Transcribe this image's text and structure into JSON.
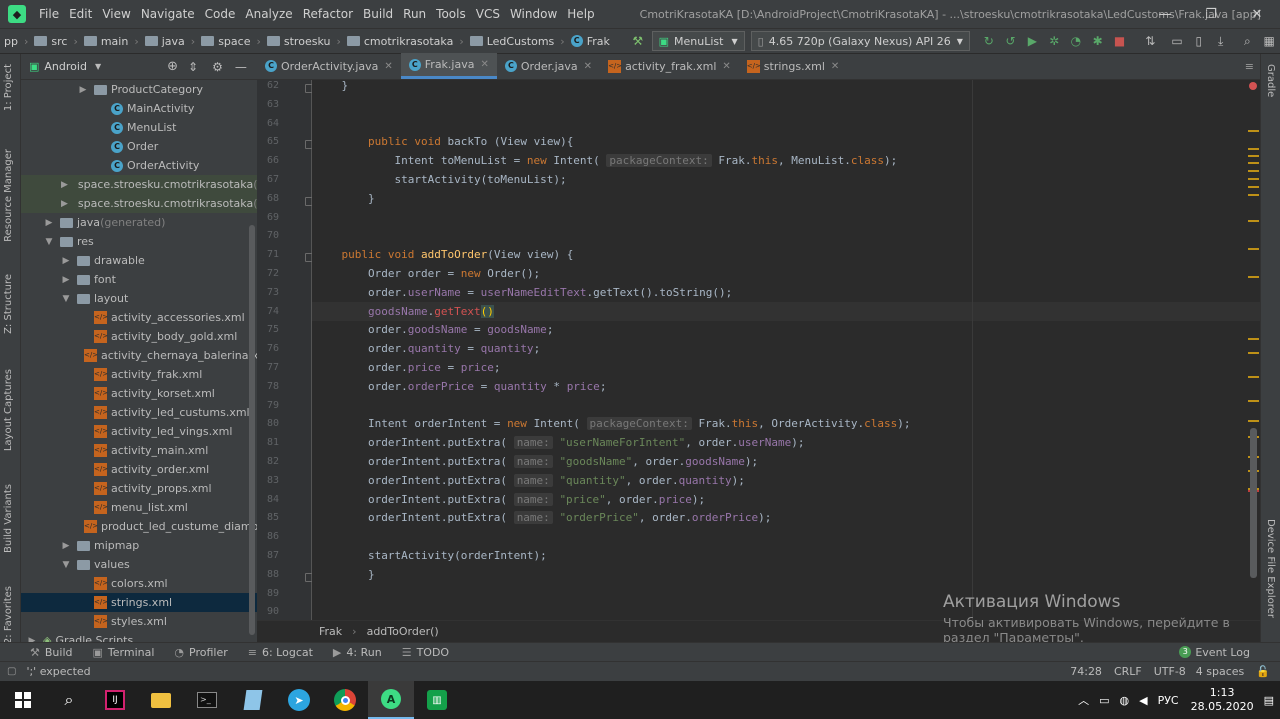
{
  "menubar": {
    "items": [
      "File",
      "Edit",
      "View",
      "Navigate",
      "Code",
      "Analyze",
      "Refactor",
      "Build",
      "Run",
      "Tools",
      "VCS",
      "Window",
      "Help"
    ],
    "title": "CmotriKrasotaKA [D:\\AndroidProject\\CmotriKrasotaKA] - ...\\stroesku\\cmotrikrasotaka\\LedCustoms\\Frak.java [app]"
  },
  "navbar": {
    "crumbs": [
      "pp",
      "src",
      "main",
      "java",
      "space",
      "stroesku",
      "cmotrikrasotaka",
      "LedCustoms",
      "Frak"
    ],
    "config": "MenuList",
    "device": "4.65  720p (Galaxy Nexus) API 26"
  },
  "project": {
    "view": "Android",
    "tree": [
      {
        "label": "ProductCategory",
        "type": "folder",
        "indent": 3,
        "arrow": "▶"
      },
      {
        "label": "MainActivity",
        "type": "class",
        "indent": 4
      },
      {
        "label": "MenuList",
        "type": "class",
        "indent": 4
      },
      {
        "label": "Order",
        "type": "class",
        "indent": 4
      },
      {
        "label": "OrderActivity",
        "type": "class",
        "indent": 4
      },
      {
        "label": "space.stroesku.cmotrikrasotaka",
        "suffix": " (a",
        "type": "pkg",
        "indent": 2,
        "arrow": "▶",
        "hl": "green"
      },
      {
        "label": "space.stroesku.cmotrikrasotaka",
        "suffix": " (t",
        "type": "pkg",
        "indent": 2,
        "arrow": "▶",
        "hl": "green"
      },
      {
        "label": "java",
        "suffix": " (generated)",
        "type": "folder",
        "indent": 1,
        "arrow": "▶"
      },
      {
        "label": "res",
        "type": "folder",
        "indent": 1,
        "arrow": "▼"
      },
      {
        "label": "drawable",
        "type": "folder",
        "indent": 2,
        "arrow": "▶"
      },
      {
        "label": "font",
        "type": "folder",
        "indent": 2,
        "arrow": "▶"
      },
      {
        "label": "layout",
        "type": "folder",
        "indent": 2,
        "arrow": "▼"
      },
      {
        "label": "activity_accessories.xml",
        "type": "xml",
        "indent": 3
      },
      {
        "label": "activity_body_gold.xml",
        "type": "xml",
        "indent": 3
      },
      {
        "label": "activity_chernaya_balerina.xml",
        "type": "xml",
        "indent": 3
      },
      {
        "label": "activity_frak.xml",
        "type": "xml",
        "indent": 3
      },
      {
        "label": "activity_korset.xml",
        "type": "xml",
        "indent": 3
      },
      {
        "label": "activity_led_custums.xml",
        "type": "xml",
        "indent": 3
      },
      {
        "label": "activity_led_vings.xml",
        "type": "xml",
        "indent": 3
      },
      {
        "label": "activity_main.xml",
        "type": "xml",
        "indent": 3
      },
      {
        "label": "activity_order.xml",
        "type": "xml",
        "indent": 3
      },
      {
        "label": "activity_props.xml",
        "type": "xml",
        "indent": 3
      },
      {
        "label": "menu_list.xml",
        "type": "xml",
        "indent": 3
      },
      {
        "label": "product_led_custume_diamond",
        "type": "xml",
        "indent": 3
      },
      {
        "label": "mipmap",
        "type": "folder",
        "indent": 2,
        "arrow": "▶"
      },
      {
        "label": "values",
        "type": "folder",
        "indent": 2,
        "arrow": "▼"
      },
      {
        "label": "colors.xml",
        "type": "xml",
        "indent": 3
      },
      {
        "label": "strings.xml",
        "type": "xml",
        "indent": 3,
        "hl": "sel"
      },
      {
        "label": "styles.xml",
        "type": "xml",
        "indent": 3
      },
      {
        "label": "Gradle Scripts",
        "type": "gradle",
        "indent": 0,
        "arrow": "▶"
      }
    ]
  },
  "left_tabs": [
    "1: Project",
    "Resource Manager",
    "Z: Structure",
    "Layout Captures",
    "Build Variants",
    "2: Favorites"
  ],
  "right_tabs": [
    "Gradle",
    "Device File Explorer"
  ],
  "tabs": [
    {
      "label": "OrderActivity.java",
      "active": false
    },
    {
      "label": "Frak.java",
      "active": true
    },
    {
      "label": "Order.java",
      "active": false
    },
    {
      "label": "activity_frak.xml",
      "active": false,
      "xml": true
    },
    {
      "label": "strings.xml",
      "active": false,
      "xml": true
    }
  ],
  "code": [
    {
      "n": 62,
      "s": [
        [
          "    }",
          ""
        ]
      ]
    },
    {
      "n": 63,
      "s": []
    },
    {
      "n": 64,
      "s": []
    },
    {
      "n": 65,
      "s": [
        [
          "        ",
          ""
        ],
        [
          "public void ",
          "kw"
        ],
        [
          "backTo",
          ""
        ],
        [
          " (View view){",
          ""
        ]
      ]
    },
    {
      "n": 66,
      "s": [
        [
          "            Intent toMenuList = ",
          ""
        ],
        [
          "new ",
          "kw"
        ],
        [
          "Intent( ",
          ""
        ],
        [
          "packageContext:",
          "hint"
        ],
        [
          " Frak.",
          ""
        ],
        [
          "this",
          "kw"
        ],
        [
          ", MenuList.",
          ""
        ],
        [
          "class",
          "kw"
        ],
        [
          ");",
          ""
        ]
      ]
    },
    {
      "n": 67,
      "s": [
        [
          "            startActivity(toMenuList);",
          ""
        ]
      ]
    },
    {
      "n": 68,
      "s": [
        [
          "        }",
          ""
        ]
      ]
    },
    {
      "n": 69,
      "s": []
    },
    {
      "n": 70,
      "s": []
    },
    {
      "n": 71,
      "s": [
        [
          "    ",
          ""
        ],
        [
          "public void ",
          "kw"
        ],
        [
          "addToOrder",
          "fn"
        ],
        [
          "(View view) {",
          ""
        ]
      ]
    },
    {
      "n": 72,
      "s": [
        [
          "        Order order = ",
          ""
        ],
        [
          "new ",
          "kw"
        ],
        [
          "Order();",
          ""
        ]
      ]
    },
    {
      "n": 73,
      "s": [
        [
          "        order.",
          ""
        ],
        [
          "userName",
          "fld"
        ],
        [
          " = ",
          ""
        ],
        [
          "userNameEditText",
          "fld"
        ],
        [
          ".getText().toString();",
          ""
        ]
      ]
    },
    {
      "n": 74,
      "s": [
        [
          "        ",
          ""
        ],
        [
          "goodsName",
          "fld"
        ],
        [
          ".",
          ""
        ],
        [
          "getText",
          "err"
        ],
        [
          "()",
          "tcur"
        ]
      ],
      "cur": true
    },
    {
      "n": 75,
      "s": [
        [
          "        order.",
          ""
        ],
        [
          "goodsName",
          "fld"
        ],
        [
          " = ",
          ""
        ],
        [
          "goodsName",
          "fld"
        ],
        [
          ";",
          ""
        ]
      ]
    },
    {
      "n": 76,
      "s": [
        [
          "        order.",
          ""
        ],
        [
          "quantity",
          "fld"
        ],
        [
          " = ",
          ""
        ],
        [
          "quantity",
          "fld"
        ],
        [
          ";",
          ""
        ]
      ]
    },
    {
      "n": 77,
      "s": [
        [
          "        order.",
          ""
        ],
        [
          "price",
          "fld"
        ],
        [
          " = ",
          ""
        ],
        [
          "price",
          "fld"
        ],
        [
          ";",
          ""
        ]
      ]
    },
    {
      "n": 78,
      "s": [
        [
          "        order.",
          ""
        ],
        [
          "orderPrice",
          "fld"
        ],
        [
          " = ",
          ""
        ],
        [
          "quantity",
          "fld"
        ],
        [
          " * ",
          ""
        ],
        [
          "price",
          "fld"
        ],
        [
          ";",
          ""
        ]
      ]
    },
    {
      "n": 79,
      "s": []
    },
    {
      "n": 80,
      "s": [
        [
          "        Intent orderIntent = ",
          ""
        ],
        [
          "new ",
          "kw"
        ],
        [
          "Intent( ",
          ""
        ],
        [
          "packageContext:",
          "hint"
        ],
        [
          " Frak.",
          ""
        ],
        [
          "this",
          "kw"
        ],
        [
          ", OrderActivity.",
          ""
        ],
        [
          "class",
          "kw"
        ],
        [
          ");",
          ""
        ]
      ]
    },
    {
      "n": 81,
      "s": [
        [
          "        orderIntent.putExtra( ",
          ""
        ],
        [
          "name:",
          "hint"
        ],
        [
          " ",
          ""
        ],
        [
          "\"userNameForIntent\"",
          "str"
        ],
        [
          ", order.",
          ""
        ],
        [
          "userName",
          "fld"
        ],
        [
          ");",
          ""
        ]
      ]
    },
    {
      "n": 82,
      "s": [
        [
          "        orderIntent.putExtra( ",
          ""
        ],
        [
          "name:",
          "hint"
        ],
        [
          " ",
          ""
        ],
        [
          "\"goodsName\"",
          "str"
        ],
        [
          ", order.",
          ""
        ],
        [
          "goodsName",
          "fld"
        ],
        [
          ");",
          ""
        ]
      ]
    },
    {
      "n": 83,
      "s": [
        [
          "        orderIntent.putExtra( ",
          ""
        ],
        [
          "name:",
          "hint"
        ],
        [
          " ",
          ""
        ],
        [
          "\"quantity\"",
          "str"
        ],
        [
          ", order.",
          ""
        ],
        [
          "quantity",
          "fld"
        ],
        [
          ");",
          ""
        ]
      ]
    },
    {
      "n": 84,
      "s": [
        [
          "        orderIntent.putExtra( ",
          ""
        ],
        [
          "name:",
          "hint"
        ],
        [
          " ",
          ""
        ],
        [
          "\"price\"",
          "str"
        ],
        [
          ", order.",
          ""
        ],
        [
          "price",
          "fld"
        ],
        [
          ");",
          ""
        ]
      ]
    },
    {
      "n": 85,
      "s": [
        [
          "        orderIntent.putExtra( ",
          ""
        ],
        [
          "name:",
          "hint"
        ],
        [
          " ",
          ""
        ],
        [
          "\"orderPrice\"",
          "str"
        ],
        [
          ", order.",
          ""
        ],
        [
          "orderPrice",
          "fld"
        ],
        [
          ");",
          ""
        ]
      ]
    },
    {
      "n": 86,
      "s": []
    },
    {
      "n": 87,
      "s": [
        [
          "        startActivity(orderIntent);",
          ""
        ]
      ]
    },
    {
      "n": 88,
      "s": [
        [
          "        }",
          ""
        ]
      ]
    },
    {
      "n": 89,
      "s": []
    },
    {
      "n": 90,
      "s": []
    }
  ],
  "breadcrumb": {
    "cls": "Frak",
    "method": "addToOrder()"
  },
  "toolwindows": [
    {
      "label": "Build",
      "icon": "hammer-icon"
    },
    {
      "label": "Terminal",
      "icon": "terminal-icon"
    },
    {
      "label": "Profiler",
      "icon": "profiler-icon"
    },
    {
      "label": "6: Logcat",
      "icon": "logcat-icon"
    },
    {
      "label": "4: Run",
      "icon": "run-icon"
    },
    {
      "label": "TODO",
      "icon": "todo-icon"
    }
  ],
  "event_log": {
    "count": "3",
    "label": "Event Log"
  },
  "status": {
    "message": "';' expected",
    "position": "74:28",
    "line_sep": "CRLF",
    "encoding": "UTF-8",
    "indent": "4 spaces"
  },
  "watermark": {
    "title": "Активация Windows",
    "line1": "Чтобы активировать Windows, перейдите в",
    "line2": "раздел \"Параметры\"."
  },
  "taskbar": {
    "lang": "РУС",
    "time": "1:13",
    "date": "28.05.2020"
  },
  "colors": {
    "accent": "#4a88c7",
    "keyword": "#cc7832",
    "string": "#6a8759",
    "field": "#9876aa",
    "method": "#ffc66d"
  }
}
